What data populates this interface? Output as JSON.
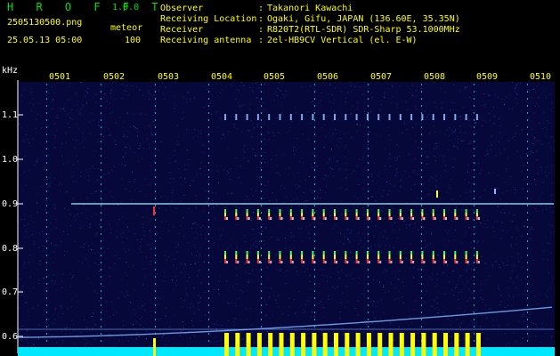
{
  "header": {
    "app_name": "H R O F F T",
    "version": "1.0.0",
    "file_name": "2505130500.png",
    "file_type": "meteor",
    "datetime": "25.05.13 05:00",
    "count": "100",
    "info": [
      {
        "label": "Observer",
        "sep": ":",
        "value": "Takanori Kawachi"
      },
      {
        "label": "Receiving Location",
        "sep": ":",
        "value": "Ogaki, Gifu, JAPAN (136.60E, 35.35N)"
      },
      {
        "label": "Receiver",
        "sep": ":",
        "value": "R820T2(RTL-SDR) SDR-Sharp 53.1000MHz"
      },
      {
        "label": "Receiving antenna",
        "sep": ":",
        "value": "2el-HB9CV Vertical (el. E-W)"
      }
    ]
  },
  "spectrogram": {
    "y_unit": "kHz",
    "time_labels": [
      "0501",
      "0502",
      "0503",
      "0504",
      "0505",
      "0506",
      "0507",
      "0508",
      "0509",
      "0510"
    ],
    "freq_labels": [
      "1.1",
      "1.0",
      "0.9",
      "0.8",
      "0.7",
      "0.6"
    ],
    "colors": {
      "background": "#06083a",
      "noise": "#2a3ca0",
      "tick": "#00ffff",
      "carrier": "#a8f0ff",
      "echo_hot": "#ff3030",
      "echo_warm": "#ffff40",
      "echo_cool": "#40ff60",
      "bar_yellow": "#ffff00",
      "bar_cyan": "#00e8ff",
      "axis_text": "#ffff00",
      "kHz_text": "#ffffff"
    }
  }
}
